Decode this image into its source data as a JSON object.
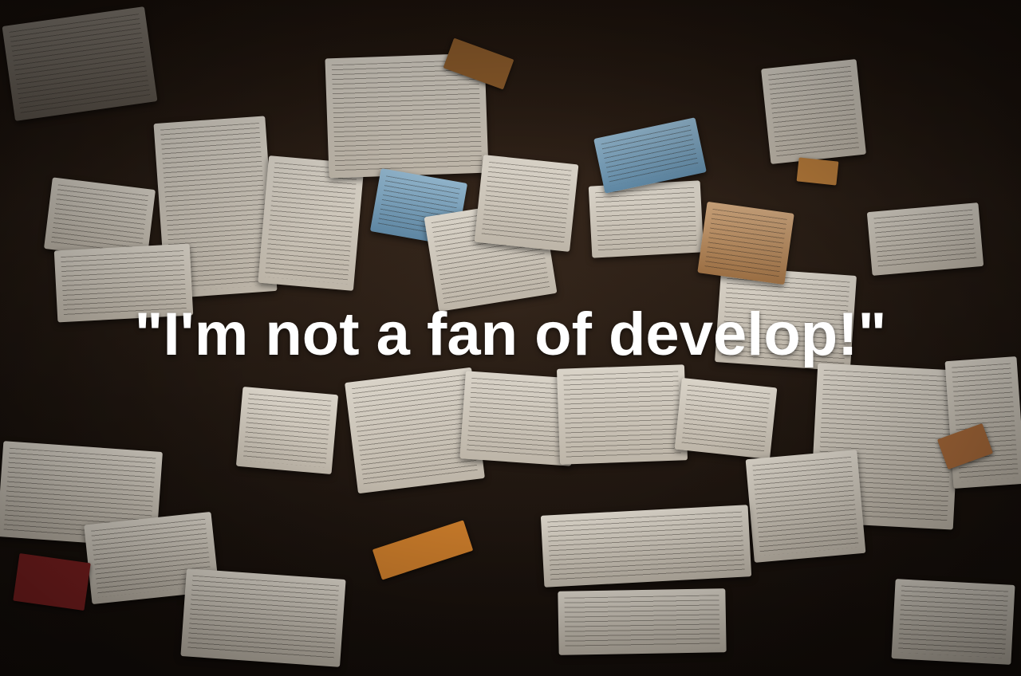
{
  "background": {
    "description_icon": "paper-pile-photo",
    "palette": [
      "#d9d3c8",
      "#9b6f44",
      "#5e86a2",
      "#2a1c12"
    ]
  },
  "quote": {
    "text": "\"I'm not a fan of develop!\""
  }
}
